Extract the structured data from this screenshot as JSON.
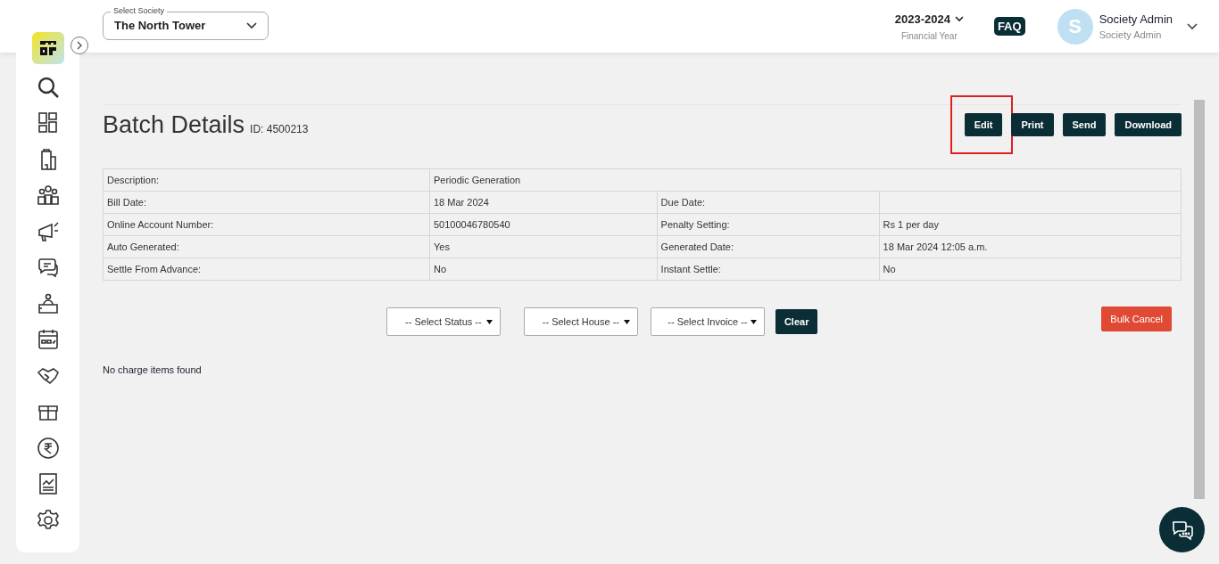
{
  "header": {
    "society_select": {
      "label": "Select Society",
      "value": "The North Tower"
    },
    "year": {
      "value": "2023-2024",
      "caption": "Financial Year"
    },
    "faq": "FAQ",
    "user": {
      "initial": "S",
      "name": "Society Admin",
      "role": "Society Admin"
    }
  },
  "page": {
    "title": "Batch Details",
    "id_text": "ID: 4500213",
    "actions": [
      {
        "label": "Edit",
        "highlighted": true
      },
      {
        "label": "Print",
        "highlighted": false
      },
      {
        "label": "Send",
        "highlighted": false
      },
      {
        "label": "Download",
        "highlighted": false
      }
    ]
  },
  "details": [
    {
      "cells": [
        "Description:",
        "Periodic Generation"
      ]
    },
    {
      "cells": [
        "Bill Date:",
        "18 Mar 2024",
        "Due Date:",
        ""
      ]
    },
    {
      "cells": [
        "Online Account Number:",
        "50100046780540",
        "Penalty Setting:",
        "Rs 1 per day"
      ]
    },
    {
      "cells": [
        "Auto Generated:",
        "Yes",
        "Generated Date:",
        "18 Mar 2024 12:05 a.m."
      ]
    },
    {
      "cells": [
        "Settle From Advance:",
        "No",
        "Instant Settle:",
        "No"
      ]
    }
  ],
  "filters": [
    {
      "placeholder": "-- Select Status --"
    },
    {
      "placeholder": "-- Select House --"
    },
    {
      "placeholder": "-- Select Invoice --"
    }
  ],
  "clear_button": "Clear",
  "bulk_cancel_button": "Bulk Cancel",
  "empty_message": "No charge items found"
}
